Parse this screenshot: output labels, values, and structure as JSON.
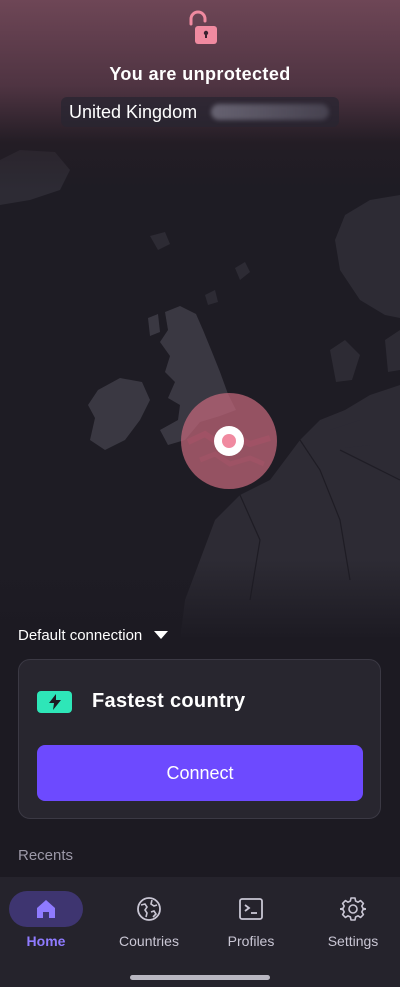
{
  "status": {
    "title": "You are unprotected",
    "country": "United Kingdom",
    "lock_icon": "unlocked-padlock-icon"
  },
  "map": {
    "marker_color": "#f08aa0",
    "highlight_color": "#c8697e"
  },
  "connection": {
    "default_label": "Default connection",
    "fastest_label": "Fastest country",
    "connect_label": "Connect",
    "bolt_icon": "lightning-bolt-icon",
    "accent_color": "#2ee6b8",
    "button_color": "#6d4aff"
  },
  "recents": {
    "title": "Recents"
  },
  "nav": {
    "items": [
      {
        "label": "Home",
        "icon": "home-icon",
        "active": true
      },
      {
        "label": "Countries",
        "icon": "globe-icon",
        "active": false
      },
      {
        "label": "Profiles",
        "icon": "terminal-icon",
        "active": false
      },
      {
        "label": "Settings",
        "icon": "gear-icon",
        "active": false
      }
    ]
  }
}
